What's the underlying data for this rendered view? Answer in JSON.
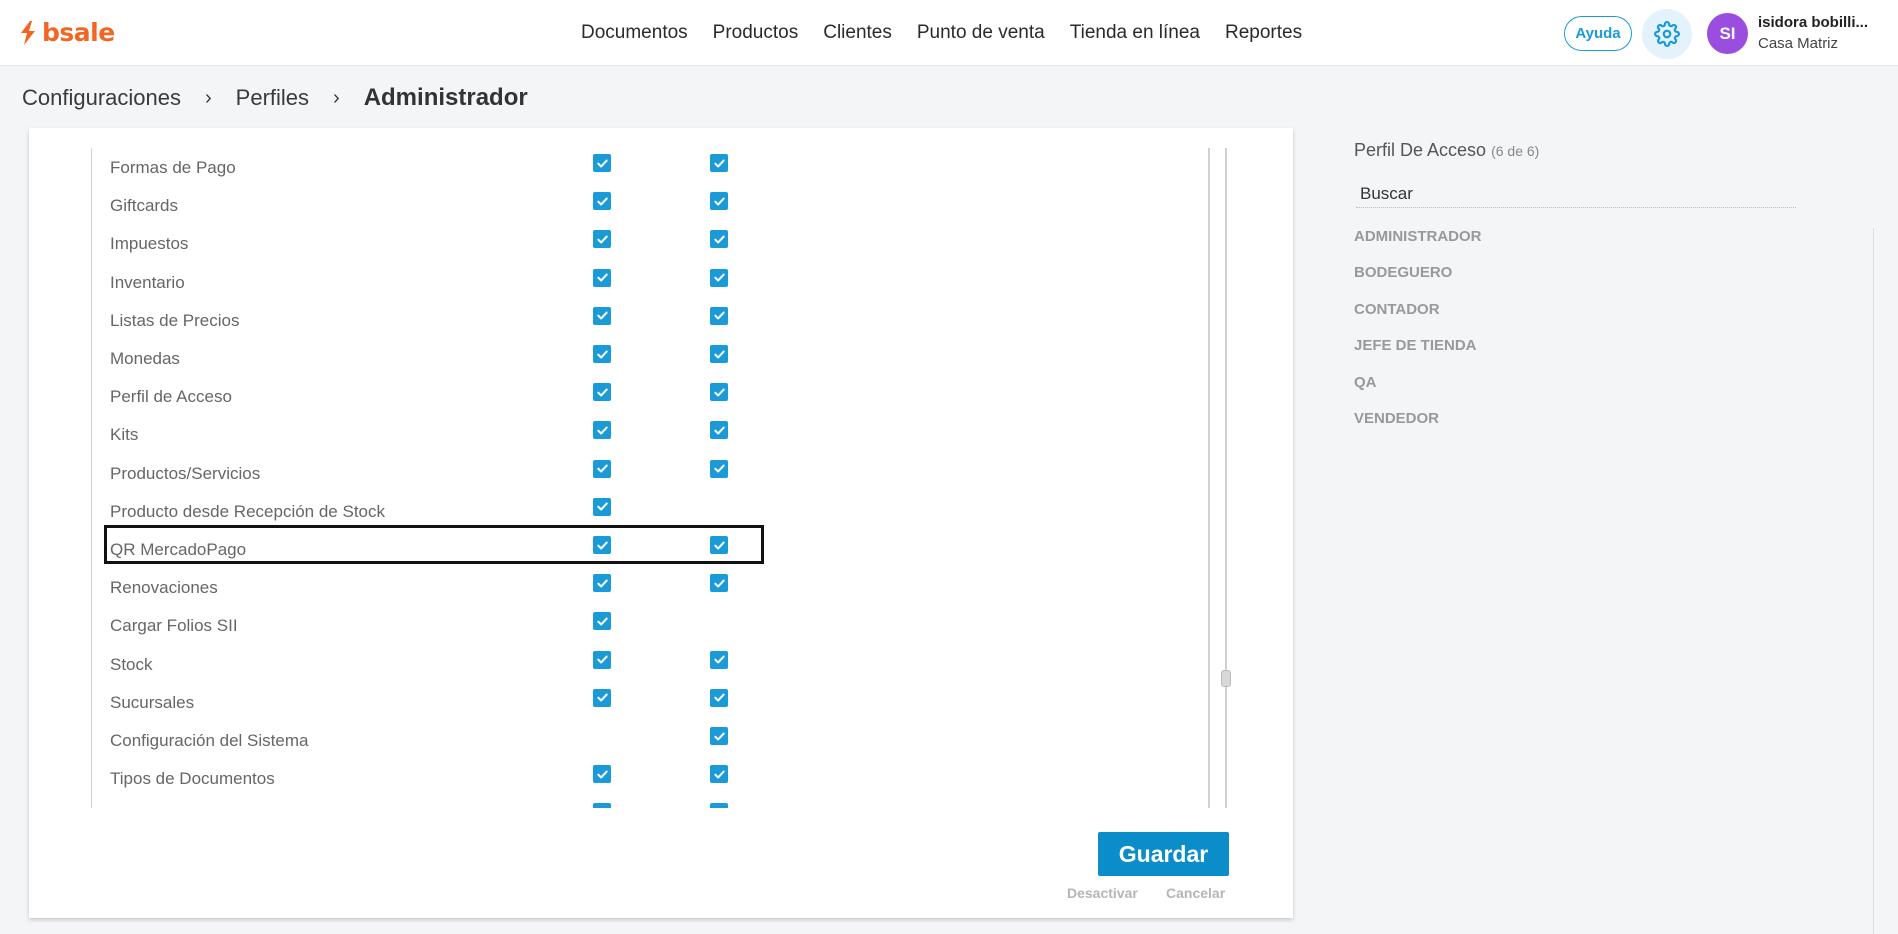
{
  "header": {
    "logo_text": "bsale",
    "nav": [
      "Documentos",
      "Productos",
      "Clientes",
      "Punto de venta",
      "Tienda en línea",
      "Reportes"
    ],
    "help_label": "Ayuda",
    "avatar_initials": "SI",
    "user_name": "isidora bobilli...",
    "user_branch": "Casa Matriz",
    "brand_color": "#f26522",
    "accent_color": "#1a9bd7"
  },
  "breadcrumb": {
    "items": [
      "Configuraciones",
      "Perfiles"
    ],
    "separator": "›",
    "current": "Administrador"
  },
  "permissions": {
    "rows": [
      {
        "label": "Formas de Pago",
        "col1": true,
        "col2": true
      },
      {
        "label": "Giftcards",
        "col1": true,
        "col2": true
      },
      {
        "label": "Impuestos",
        "col1": true,
        "col2": true
      },
      {
        "label": "Inventario",
        "col1": true,
        "col2": true
      },
      {
        "label": "Listas de Precios",
        "col1": true,
        "col2": true
      },
      {
        "label": "Monedas",
        "col1": true,
        "col2": true
      },
      {
        "label": "Perfil de Acceso",
        "col1": true,
        "col2": true
      },
      {
        "label": "Kits",
        "col1": true,
        "col2": true
      },
      {
        "label": "Productos/Servicios",
        "col1": true,
        "col2": true
      },
      {
        "label": "Producto desde Recepción de Stock",
        "col1": true,
        "col2": false
      },
      {
        "label": "QR MercadoPago",
        "col1": true,
        "col2": true,
        "highlighted": true
      },
      {
        "label": "Renovaciones",
        "col1": true,
        "col2": true
      },
      {
        "label": "Cargar Folios SII",
        "col1": true,
        "col2": false
      },
      {
        "label": "Stock",
        "col1": true,
        "col2": true
      },
      {
        "label": "Sucursales",
        "col1": true,
        "col2": true
      },
      {
        "label": "Configuración del Sistema",
        "col1": false,
        "col2": true
      },
      {
        "label": "Tipos de Documentos",
        "col1": true,
        "col2": true
      },
      {
        "label": "",
        "col1": true,
        "col2": true
      }
    ]
  },
  "actions": {
    "save_label": "Guardar",
    "deactivate_label": "Desactivar",
    "cancel_label": "Cancelar"
  },
  "sidebar": {
    "title": "Perfil De Acceso",
    "count": "(6 de 6)",
    "search_placeholder": "Buscar",
    "profiles": [
      "ADMINISTRADOR",
      "BODEGUERO",
      "CONTADOR",
      "JEFE DE TIENDA",
      "QA",
      "VENDEDOR"
    ]
  }
}
